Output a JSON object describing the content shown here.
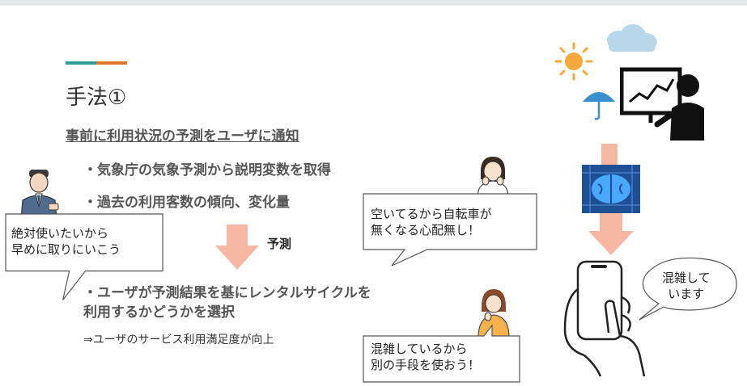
{
  "title": "手法①",
  "subtitle": "事前に利用状況の予測をユーザに通知",
  "bullets": [
    "・気象庁の気象予測から説明変数を取得",
    "・過去の利用客数の傾向、変化量"
  ],
  "arrow_label": "予測",
  "result_line1": "・ユーザが予測結果を基にレンタルサイクルを",
  "result_line2": "利用するかどうかを選択",
  "conclusion": "⇒ユーザのサービス利用満足度が向上",
  "callouts": {
    "businessman": "絶対使いたいから\n早めに取りにいこう",
    "woman_top": "空いてるから自転車が\n無くなる心配無し！",
    "woman_bottom": "混雑しているから\n別の手段を使おう！",
    "phone": "混雑して\nいます"
  },
  "colors": {
    "teal": "#2e9c96",
    "orange": "#e0762c",
    "arrow": "#f7b8a3",
    "sun": "#f6a93b",
    "cloud": "#b9d7ea",
    "umbrella": "#3a8fd0",
    "brain": "#2a70c8"
  }
}
